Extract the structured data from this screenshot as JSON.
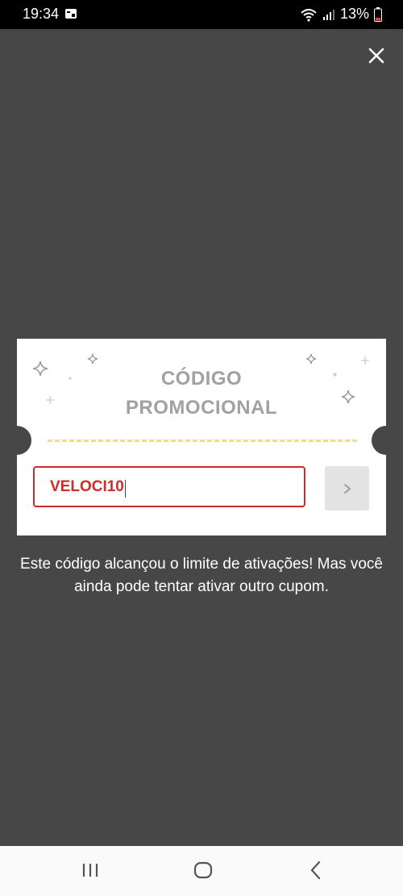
{
  "status_bar": {
    "time": "19:34",
    "battery": "13%"
  },
  "promo": {
    "title_line1": "CÓDIGO",
    "title_line2": "PROMOCIONAL",
    "code_value": "VELOCI10",
    "error_text": "Este código alcançou o limite de ativações! Mas você ainda pode tentar ativar outro cupom."
  },
  "colors": {
    "overlay": "#474747",
    "error": "#d12a2a",
    "dash": "#f2dc8a",
    "title": "#a1a1a1"
  }
}
